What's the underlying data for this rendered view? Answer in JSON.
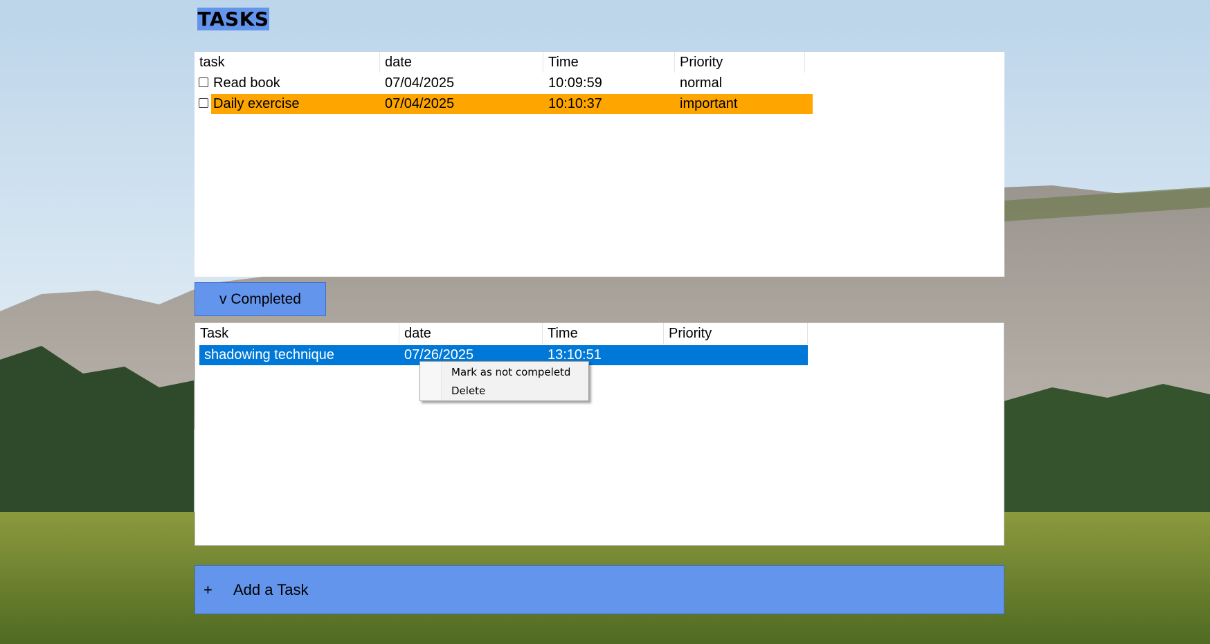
{
  "title": "TASKS",
  "tasks": {
    "columns": [
      "task",
      "date",
      "Time",
      "Priority"
    ],
    "rows": [
      {
        "task": "Read book",
        "date": "07/04/2025",
        "time": "10:09:59",
        "priority": "normal",
        "checked": false
      },
      {
        "task": "Daily exercise",
        "date": "07/04/2025",
        "time": "10:10:37",
        "priority": "important",
        "checked": false
      }
    ]
  },
  "completed_toggle": {
    "label": "v Completed"
  },
  "completed": {
    "columns": [
      "Task",
      "date",
      "Time",
      "Priority"
    ],
    "rows": [
      {
        "task": "shadowing technique",
        "date": "07/26/2025",
        "time": "13:10:51",
        "priority": ""
      }
    ]
  },
  "context_menu": {
    "items": [
      "Mark as not compeletd",
      "Delete"
    ]
  },
  "add_task": {
    "icon": "+",
    "label": "Add a Task"
  },
  "colors": {
    "accent": "#6495ed",
    "important_highlight": "#ffa500",
    "selection": "#0078d7"
  }
}
